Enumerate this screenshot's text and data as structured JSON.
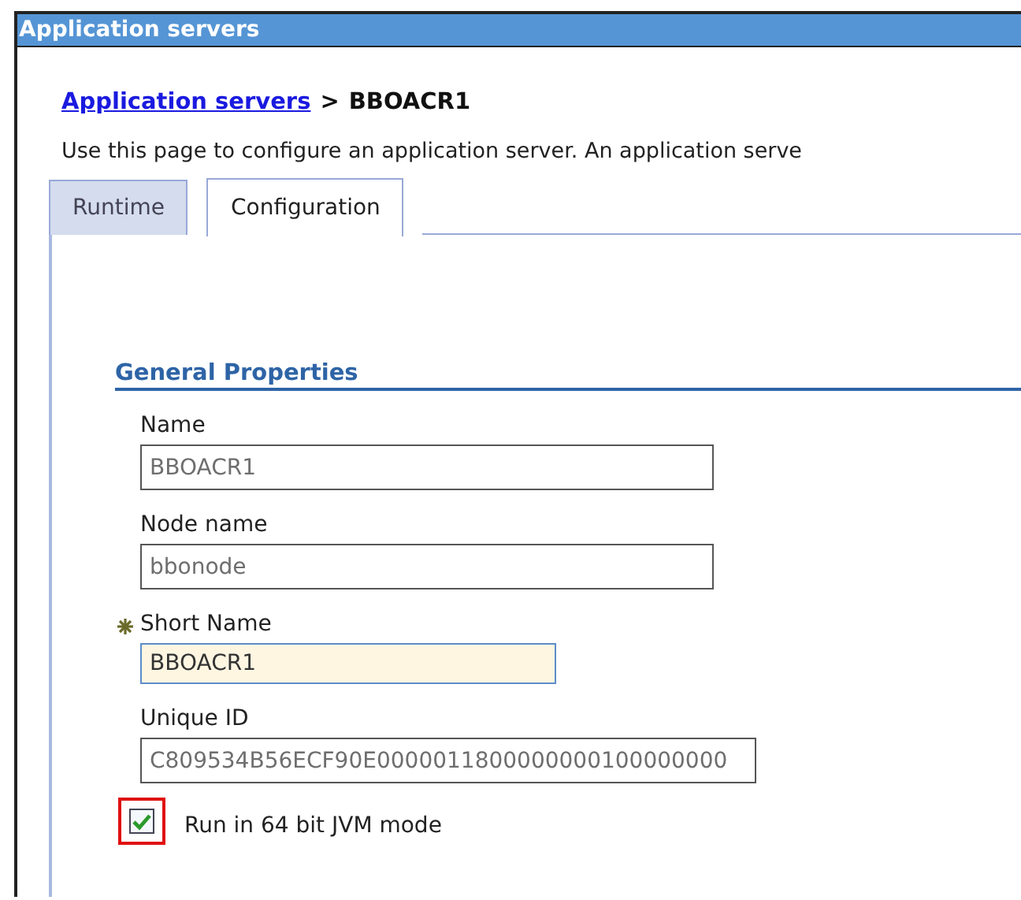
{
  "window": {
    "title": "Application servers"
  },
  "breadcrumb": {
    "link": "Application servers",
    "separator": ">",
    "current": "BBOACR1"
  },
  "description": "Use this page to configure an application server. An application serve",
  "tabs": [
    {
      "label": "Runtime",
      "selected": false
    },
    {
      "label": "Configuration",
      "selected": true
    }
  ],
  "section": {
    "title": "General Properties"
  },
  "fields": [
    {
      "label": "Name",
      "value": "BBOACR1",
      "required": false,
      "readonly": true
    },
    {
      "label": "Node name",
      "value": "bbonode",
      "required": false,
      "readonly": true
    },
    {
      "label": "Short Name",
      "value": "BBOACR1",
      "required": true,
      "readonly": false
    },
    {
      "label": "Unique ID",
      "value": "C809534B56ECF90E0000011800000000100000000",
      "required": false,
      "readonly": true
    }
  ],
  "checkbox": {
    "label": "Run in 64 bit JVM mode",
    "checked": true,
    "highlighted": true
  }
}
